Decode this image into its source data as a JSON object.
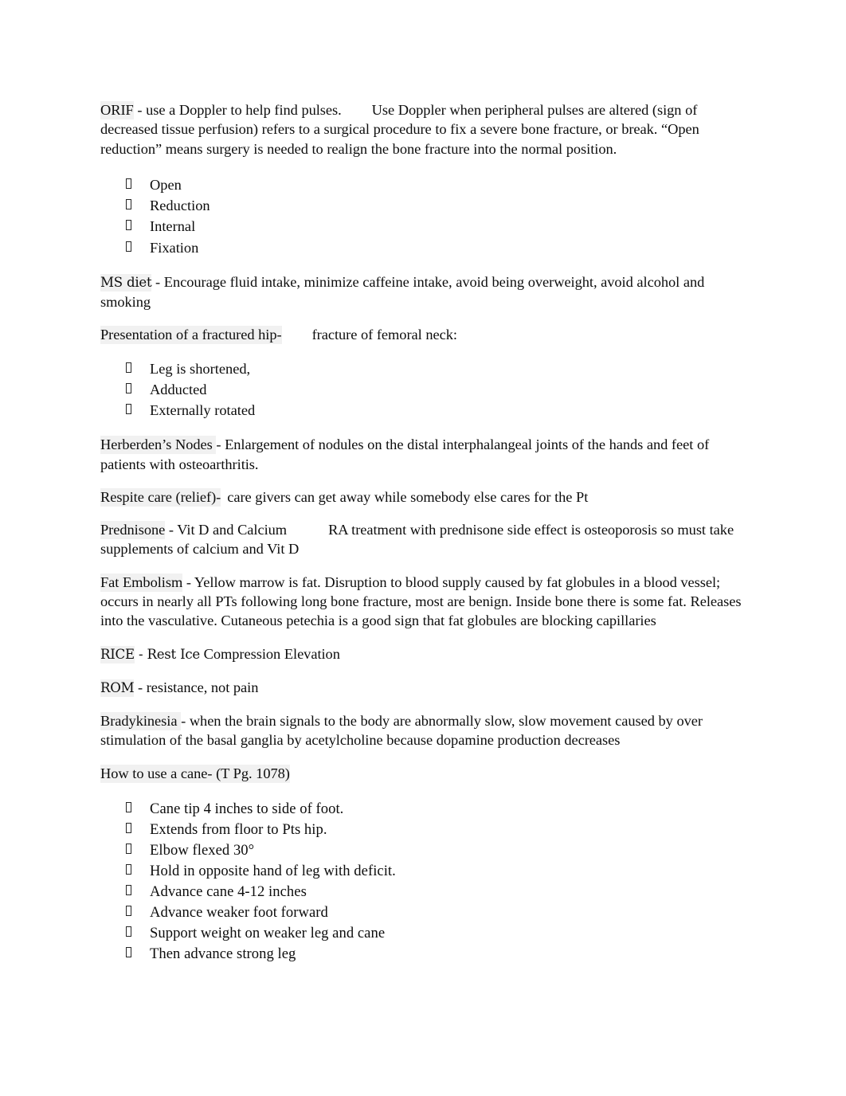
{
  "document": {
    "background_color": "#ffffff",
    "text_color": "#0d0d0d",
    "highlight_color": "#f1f1f1"
  },
  "content": {
    "orif": {
      "term": "ORIF",
      "body_a": " - use a Doppler to help find pulses.",
      "body_b": "Use Doppler when peripheral pulses are altered (sign of decreased tissue perfusion) refers to a surgical procedure to fix a severe bone fracture, or break. “Open reduction” means surgery is needed to realign the bone fracture into the normal position.",
      "bullets": [
        "Open",
        "Reduction",
        "Internal",
        "Fixation"
      ]
    },
    "ms_diet": {
      "term": "MS diet",
      "body": " - Encourage fluid intake, minimize caffeine intake, avoid being overweight, avoid alcohol and smoking"
    },
    "fractured_hip": {
      "term": "Presentation of a fractured hip-",
      "body": "fracture of femoral neck:",
      "bullets": [
        "Leg is shortened,",
        "Adducted",
        "Externally rotated"
      ]
    },
    "herberden": {
      "term": "Herberden’s Nodes ",
      "body": " - Enlargement of nodules on the distal interphalangeal joints of the hands and feet of patients with osteoarthritis."
    },
    "respite": {
      "term": "Respite care (relief)-",
      "body": "care givers can get away while somebody else cares for the Pt"
    },
    "prednisone": {
      "term": "Prednisone",
      "body_a": " - Vit D and Calcium",
      "body_b": "RA treatment with prednisone side effect is osteoporosis so must take supplements of calcium and Vit D"
    },
    "fat_embolism": {
      "term": "Fat Embolism",
      "body": " - Yellow marrow is fat.  Disruption to blood supply caused by fat globules in a blood vessel; occurs in nearly all PTs following long bone fracture, most are benign.  Inside bone there is some fat.  Releases into the vasculative.  Cutaneous petechia is a good sign that fat globules are blocking capillaries"
    },
    "rice": {
      "term": "RICE",
      "body_a": " - Rest Ice",
      "body_b": " Compression Elevation"
    },
    "rom": {
      "term": "ROM",
      "body": " - resistance, not pain"
    },
    "bradykinesia": {
      "term": "Bradykinesia ",
      "body": " - when the brain signals to the body are abnormally slow, slow movement caused by over stimulation of the basal ganglia by acetylcholine because dopamine production decreases"
    },
    "cane": {
      "term": "How to use a cane- (T Pg. 1078)",
      "bullets": [
        "Cane tip 4 inches to side of foot.",
        "Extends from floor to Pts hip.",
        "Elbow flexed 30°",
        "Hold in opposite hand of leg with deficit.",
        "Advance cane 4-12 inches",
        "Advance weaker foot forward",
        "Support weight on weaker leg and cane",
        "Then advance strong leg"
      ]
    }
  }
}
